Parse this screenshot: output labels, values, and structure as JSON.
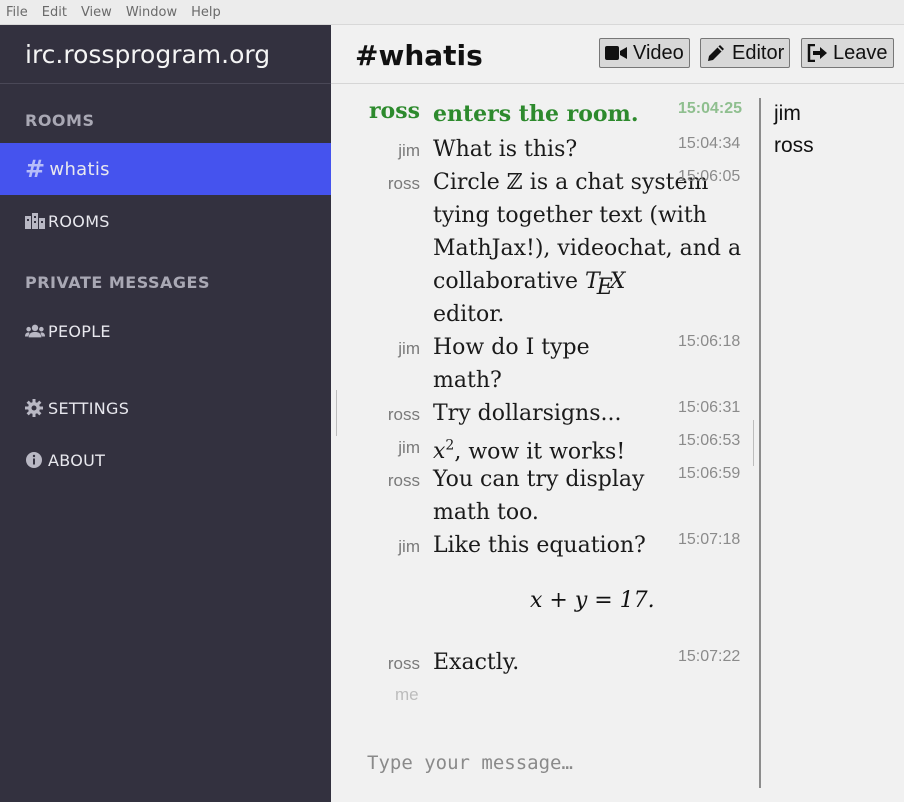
{
  "menubar": [
    "File",
    "Edit",
    "View",
    "Window",
    "Help"
  ],
  "sidebar": {
    "server": "irc.rossprogram.org",
    "rooms_title": "ROOMS",
    "active_room": "whatis",
    "rooms_link": "ROOMS",
    "pm_title": "PRIVATE MESSAGES",
    "people": "PEOPLE",
    "settings": "SETTINGS",
    "about": "ABOUT"
  },
  "header": {
    "title": "#whatis",
    "video": "Video",
    "editor": "Editor",
    "leave": "Leave"
  },
  "messages": [
    {
      "nick": "ross",
      "text": "enters the room.",
      "time": "15:04:25"
    },
    {
      "nick": "jim",
      "text": "What is this?",
      "time": "15:04:34"
    },
    {
      "nick": "ross",
      "text": "Circle ℤ is a chat system tying together text (with MathJax!), videochat, and a collaborative",
      "text2": "editor.",
      "time": "15:06:05"
    },
    {
      "nick": "jim",
      "text": "How do I type math?",
      "time": "15:06:18"
    },
    {
      "nick": "ross",
      "text": "Try dollarsigns...",
      "time": "15:06:31"
    },
    {
      "nick": "jim",
      "text": ", wow it works!",
      "time": "15:06:53"
    },
    {
      "nick": "ross",
      "text": "You can try display math too.",
      "time": "15:06:59"
    },
    {
      "nick": "jim",
      "text": "Like this equation?",
      "time": "15:07:18"
    },
    {
      "nick": "ross",
      "text": "Exactly.",
      "time": "15:07:22"
    }
  ],
  "display_math": "x + y = 17.",
  "me": "me",
  "input_placeholder": "Type your message…",
  "users": [
    "jim",
    "ross"
  ]
}
